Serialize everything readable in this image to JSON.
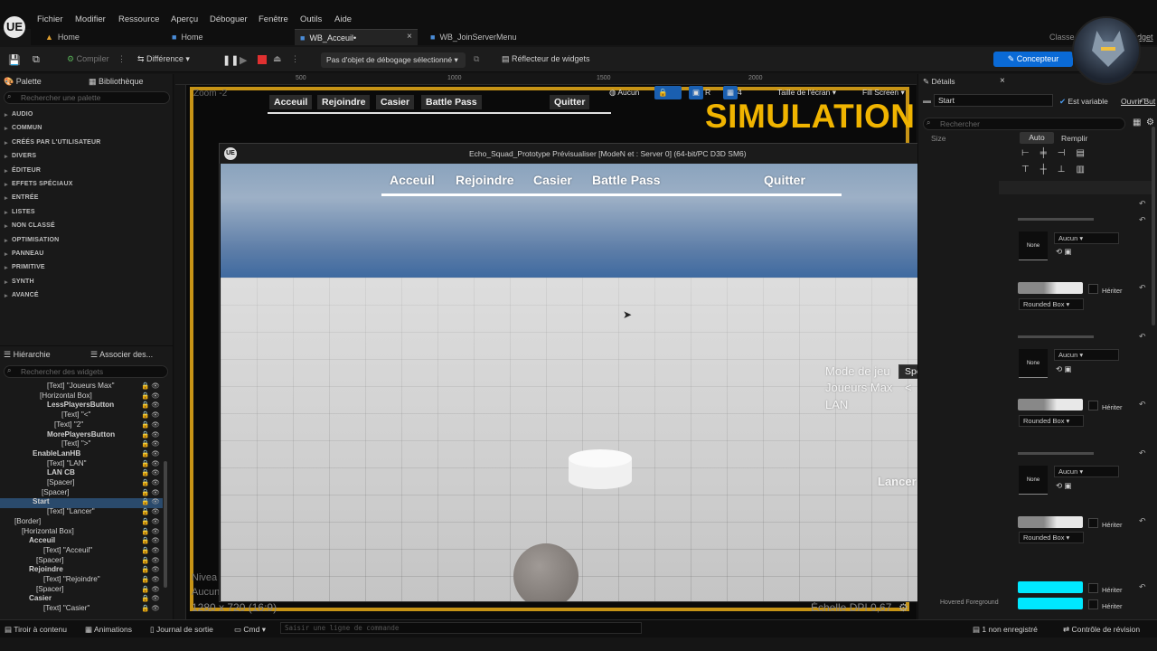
{
  "app": {
    "logo": "UE",
    "menu": [
      "Fichier",
      "Modifier",
      "Ressource",
      "Aperçu",
      "Déboguer",
      "Fenêtre",
      "Outils",
      "Aide"
    ]
  },
  "tabs": [
    {
      "label": "Home",
      "icon": "home-icon"
    },
    {
      "label": "Home",
      "icon": "blueprint-icon"
    },
    {
      "label": "WB_Acceuil•",
      "icon": "widget-blueprint-icon",
      "active": true
    },
    {
      "label": "WB_JoinServerMenu",
      "icon": "widget-blueprint-icon"
    }
  ],
  "tab_close": "×",
  "title_right": {
    "classe": "Classe",
    "dget": "dget"
  },
  "toolbar": {
    "compiler": "Compiler",
    "difference": "Différence",
    "debug_select": "Pas d'objet de débogage sélectionné",
    "reflector": "Réflecteur de widgets",
    "concepteur": "Concepteur"
  },
  "left_panel": {
    "palette_tab": "Palette",
    "library_tab": "Bibliothèque",
    "palette_search": "Rechercher une palette",
    "categories": [
      "AUDIO",
      "COMMUN",
      "CRÉÉS PAR L'UTILISATEUR",
      "DIVERS",
      "ÉDITEUR",
      "EFFETS SPÉCIAUX",
      "ENTRÉE",
      "LISTES",
      "NON CLASSÉ",
      "OPTIMISATION",
      "PANNEAU",
      "PRIMITIVE",
      "SYNTH",
      "AVANCÉ"
    ],
    "hierarchy_tab": "Hiérarchie",
    "assoc_tab": "Associer des...",
    "widget_search": "Rechercher des widgets",
    "tree": [
      {
        "label": "[Text] \"Joueurs Max\"",
        "indent": 52,
        "bold": false
      },
      {
        "label": "[Horizontal Box]",
        "indent": 44,
        "bold": false
      },
      {
        "label": "LessPlayersButton",
        "indent": 52,
        "bold": true
      },
      {
        "label": "[Text] \"<\"",
        "indent": 68,
        "bold": false
      },
      {
        "label": "[Text] \"2\"",
        "indent": 60,
        "bold": false
      },
      {
        "label": "MorePlayersButton",
        "indent": 52,
        "bold": true
      },
      {
        "label": "[Text] \">\"",
        "indent": 68,
        "bold": false
      },
      {
        "label": "EnableLanHB",
        "indent": 36,
        "bold": true
      },
      {
        "label": "[Text] \"LAN\"",
        "indent": 52,
        "bold": false
      },
      {
        "label": "LAN CB",
        "indent": 52,
        "bold": true
      },
      {
        "label": "[Spacer]",
        "indent": 52,
        "bold": false
      },
      {
        "label": "[Spacer]",
        "indent": 46,
        "bold": false
      },
      {
        "label": "Start",
        "indent": 36,
        "bold": true,
        "selected": true
      },
      {
        "label": "[Text] \"Lancer\"",
        "indent": 52,
        "bold": false
      },
      {
        "label": "[Border]",
        "indent": 16,
        "bold": false
      },
      {
        "label": "[Horizontal Box]",
        "indent": 24,
        "bold": false
      },
      {
        "label": "Acceuil",
        "indent": 32,
        "bold": true
      },
      {
        "label": "[Text] \"Acceuil\"",
        "indent": 48,
        "bold": false
      },
      {
        "label": "[Spacer]",
        "indent": 40,
        "bold": false
      },
      {
        "label": "Rejoindre",
        "indent": 32,
        "bold": true
      },
      {
        "label": "[Text] \"Rejoindre\"",
        "indent": 48,
        "bold": false
      },
      {
        "label": "[Spacer]",
        "indent": 40,
        "bold": false
      },
      {
        "label": "Casier",
        "indent": 32,
        "bold": true
      },
      {
        "label": "[Text] \"Casier\"",
        "indent": 48,
        "bold": false
      }
    ]
  },
  "canvas": {
    "zoom": "Zoom -2",
    "ruler": [
      "500",
      "1000",
      "1500",
      "2000"
    ],
    "nav": [
      "Acceuil",
      "Rejoindre",
      "Casier",
      "Battle Pass",
      "Quitter"
    ],
    "simulation": "SIMULATION",
    "tools": {
      "aucun": "Aucun",
      "r": "R",
      "grid_num": "4",
      "screen_size": "Taille de l'écran",
      "fill": "Fill Screen"
    },
    "bottom_left_1": "Nivea",
    "bottom_left_2": "Aucun",
    "resolution": "1280 x 720 (16:9)",
    "dpi": "Échelle DPI 0,67"
  },
  "preview": {
    "title": "Echo_Squad_Prototype Prévisualiser [ModeN et : Server 0]  (64-bit/PC D3D SM6)",
    "controls": "—   ☐   ✕",
    "nav": [
      "Acceuil",
      "Rejoindre",
      "Casier",
      "Battle Pass",
      "Quitter"
    ],
    "mode_label": "Mode de jeu",
    "mode_value": "SpeedShip",
    "players_label": "Joueurs Max",
    "players_less": "<",
    "players_value": "24",
    "players_more": ">",
    "lan_label": "LAN",
    "launch": "Lancer"
  },
  "details": {
    "tab": "Détails",
    "name": "Start",
    "is_variable": "Est variable",
    "open": "Ouvrir But",
    "search": "Rechercher",
    "size_label": "Size",
    "auto": "Auto",
    "fill": "Remplir",
    "none": "None",
    "aucun": "Aucun",
    "heriter": "Hériter",
    "rounded_box": "Rounded Box",
    "hovered": "Hovered Foreground",
    "cyan": "#00e8ff"
  },
  "statusbar": {
    "drawer": "Tiroir à contenu",
    "animations": "Animations",
    "log": "Journal de sortie",
    "cmd": "Cmd",
    "cmd_placeholder": "Saisir une ligne de commande",
    "unsaved": "1 non enregistré",
    "revision": "Contrôle de révision"
  }
}
